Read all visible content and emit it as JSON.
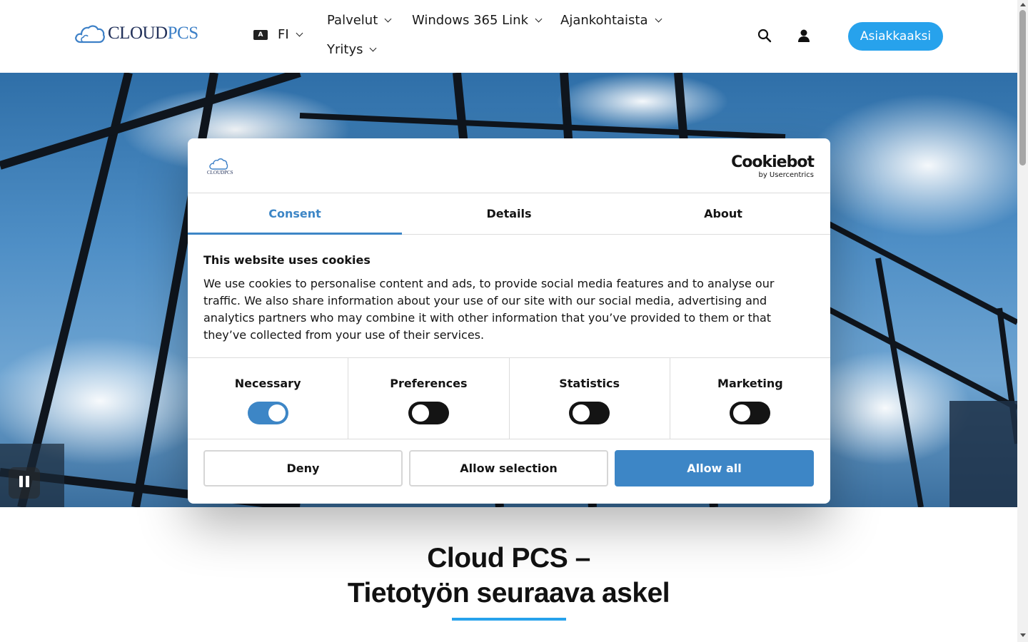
{
  "header": {
    "logo": {
      "cloud": "CLOUD",
      "pcs": "PCS"
    },
    "language": {
      "icon": "translate-icon",
      "code": "FI"
    },
    "nav": [
      {
        "label": "Palvelut"
      },
      {
        "label": "Windows 365 Link"
      },
      {
        "label": "Ajankohtaista"
      },
      {
        "label": "Yritys"
      }
    ],
    "search_icon": "search-icon",
    "account_icon": "user-icon",
    "cta_label": "Asiakkaaksi",
    "accent_color": "#27a2ec"
  },
  "hero": {
    "pause_icon": "pause-icon"
  },
  "cookie_dialog": {
    "provider": {
      "name": "Cookiebot",
      "by": "by Usercentrics"
    },
    "tabs": [
      {
        "label": "Consent",
        "active": true
      },
      {
        "label": "Details",
        "active": false
      },
      {
        "label": "About",
        "active": false
      }
    ],
    "title": "This website uses cookies",
    "text": "We use cookies to personalise content and ads, to provide social media features and to analyse our traffic. We also share information about your use of our site with our social media, advertising and analytics partners who may combine it with other information that you’ve provided to them or that they’ve collected from your use of their services.",
    "categories": [
      {
        "label": "Necessary",
        "enabled": true
      },
      {
        "label": "Preferences",
        "enabled": false
      },
      {
        "label": "Statistics",
        "enabled": false
      },
      {
        "label": "Marketing",
        "enabled": false
      }
    ],
    "buttons": {
      "deny": "Deny",
      "allow_selection": "Allow selection",
      "allow_all": "Allow all"
    },
    "accent_color": "#3d86c6"
  },
  "headline": {
    "line1": "Cloud PCS –",
    "line2": "Tietotyön seuraava askel"
  }
}
